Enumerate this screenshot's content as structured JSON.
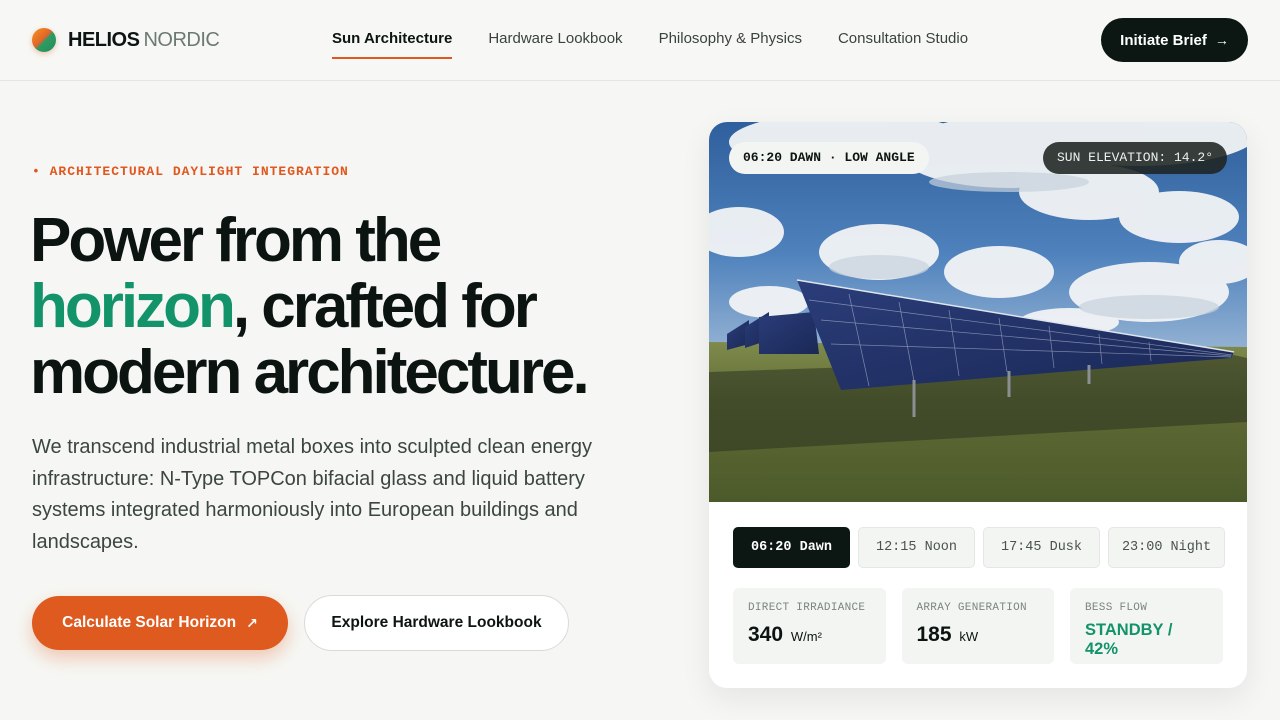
{
  "brand": {
    "name_bold": "HELIOS",
    "name_light": "NORDIC"
  },
  "nav": {
    "items": [
      {
        "label": "Sun Architecture",
        "active": true
      },
      {
        "label": "Hardware Lookbook",
        "active": false
      },
      {
        "label": "Philosophy & Physics",
        "active": false
      },
      {
        "label": "Consultation Studio",
        "active": false
      }
    ],
    "cta_label": "Initiate Brief"
  },
  "hero": {
    "eyebrow": "• ARCHITECTURAL DAYLIGHT INTEGRATION",
    "headline_line1": "Power from the",
    "headline_accent": "horizon",
    "headline_line2_rest": ", crafted for",
    "headline_line3": "modern architecture.",
    "lede": "We transcend industrial metal boxes into sculpted clean energy infrastructure: N-Type TOPCon bifacial glass and liquid battery systems integrated harmoniously into European buildings and landscapes.",
    "primary_button": "Calculate Solar Horizon",
    "secondary_button": "Explore Hardware Lookbook"
  },
  "card": {
    "time_pill": "06:20 DAWN · LOW ANGLE",
    "elevation_pill": "SUN ELEVATION: 14.2°",
    "time_options": [
      {
        "label": "06:20 Dawn",
        "active": true
      },
      {
        "label": "12:15 Noon",
        "active": false
      },
      {
        "label": "17:45 Dusk",
        "active": false
      },
      {
        "label": "23:00 Night",
        "active": false
      }
    ],
    "metrics": [
      {
        "label": "DIRECT IRRADIANCE",
        "value": "340",
        "unit": "W/m²"
      },
      {
        "label": "ARRAY GENERATION",
        "value": "185",
        "unit": "kW"
      },
      {
        "label": "BESS FLOW",
        "value": "STANDBY / 42%",
        "unit": ""
      }
    ]
  },
  "colors": {
    "accent_orange": "#df5a1f",
    "accent_green": "#13936a",
    "ink": "#0c1714",
    "background": "#f6f7f4"
  },
  "icons": {
    "cta_arrow": "arrow-right-icon",
    "primary_arrow": "arrow-up-right-icon",
    "logo": "sun-gradient-logo"
  }
}
